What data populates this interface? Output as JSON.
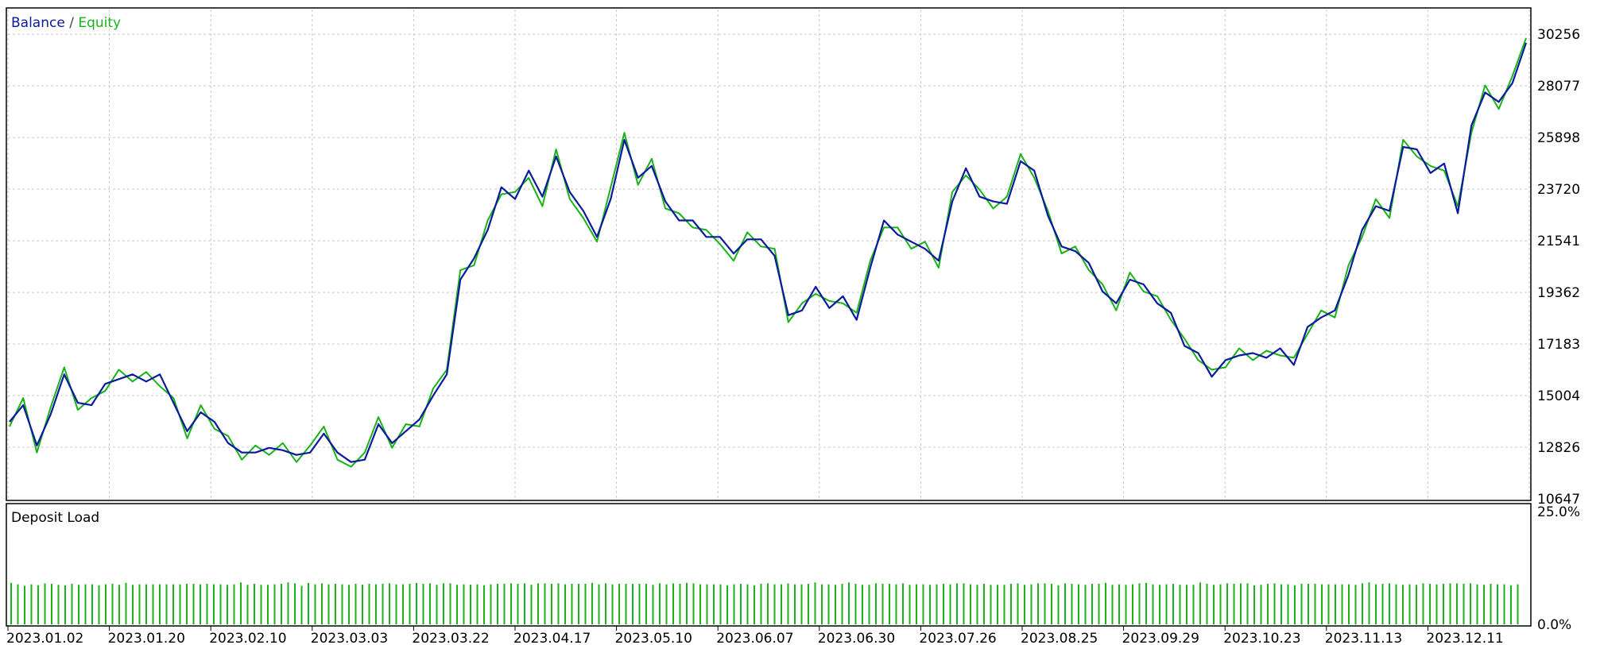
{
  "chart_data": [
    {
      "type": "line",
      "legend": {
        "placement": "top-left",
        "separator": " / "
      },
      "series": [
        {
          "name": "Balance",
          "color": "#0a1a9c",
          "values": [
            13900,
            14600,
            12900,
            14200,
            15900,
            14700,
            14600,
            15500,
            15700,
            15900,
            15600,
            15900,
            14700,
            13500,
            14300,
            13900,
            13000,
            12600,
            12600,
            12800,
            12700,
            12500,
            12600,
            13400,
            12600,
            12200,
            12300,
            13800,
            13000,
            13500,
            14000,
            15000,
            15900,
            19900,
            20800,
            22000,
            23800,
            23300,
            24500,
            23400,
            25100,
            23600,
            22800,
            21700,
            23300,
            25800,
            24200,
            24700,
            23200,
            22400,
            22400,
            21700,
            21700,
            21000,
            21600,
            21600,
            20900,
            18400,
            18600,
            19600,
            18700,
            19200,
            18200,
            20400,
            22400,
            21800,
            21500,
            21200,
            20700,
            23200,
            24600,
            23400,
            23200,
            23100,
            24900,
            24500,
            22600,
            21300,
            21100,
            20600,
            19400,
            18900,
            19900,
            19700,
            18900,
            18500,
            17100,
            16800,
            15800,
            16500,
            16700,
            16800,
            16600,
            17000,
            16300,
            17900,
            18300,
            18600,
            20100,
            22000,
            23000,
            22800,
            25500,
            25400,
            24400,
            24800,
            22700,
            26400,
            27800,
            27400,
            28200,
            29900
          ]
        },
        {
          "name": "Equity",
          "color": "#19b319",
          "values": [
            13700,
            14900,
            12600,
            14500,
            16200,
            14400,
            14900,
            15200,
            16100,
            15600,
            16000,
            15400,
            14900,
            13200,
            14600,
            13600,
            13300,
            12300,
            12900,
            12500,
            13000,
            12200,
            12900,
            13700,
            12300,
            12000,
            12600,
            14100,
            12800,
            13800,
            13700,
            15300,
            16100,
            20300,
            20500,
            22400,
            23500,
            23600,
            24200,
            23000,
            25400,
            23300,
            22500,
            21500,
            23800,
            26100,
            23900,
            25000,
            22900,
            22700,
            22100,
            22000,
            21400,
            20700,
            21900,
            21300,
            21200,
            18100,
            18900,
            19300,
            19000,
            18900,
            18500,
            20700,
            22100,
            22100,
            21200,
            21500,
            20400,
            23600,
            24300,
            23700,
            22900,
            23400,
            25200,
            24200,
            22800,
            21000,
            21300,
            20300,
            19700,
            18600,
            20200,
            19400,
            19200,
            18200,
            17400,
            16500,
            16100,
            16200,
            17000,
            16500,
            16900,
            16700,
            16600,
            17600,
            18600,
            18300,
            20500,
            21700,
            23300,
            22500,
            25800,
            25100,
            24700,
            24500,
            23000,
            26100,
            28100,
            27100,
            28500,
            30100
          ]
        }
      ],
      "x": [
        "2023.01.02",
        "2023.01.20",
        "2023.02.10",
        "2023.03.03",
        "2023.03.22",
        "2023.04.17",
        "2023.05.10",
        "2023.06.07",
        "2023.06.30",
        "2023.07.26",
        "2023.08.25",
        "2023.09.29",
        "2023.10.23",
        "2023.11.13",
        "2023.12.11"
      ],
      "ylim": [
        10647,
        31300
      ],
      "yticks": [
        "30256",
        "28077",
        "25898",
        "23720",
        "21541",
        "19362",
        "17183",
        "15004",
        "12826",
        "10647"
      ],
      "grid": true
    },
    {
      "type": "bar",
      "title": "Deposit Load",
      "color": "#19b319",
      "ylim": [
        0,
        25
      ],
      "yticks": [
        "25.0%",
        "0.0%"
      ],
      "values": [
        8.7,
        8.4,
        8.1,
        8.4,
        8.2,
        8.6,
        8.5,
        8.3,
        8.2,
        8.5,
        8.3,
        8.4,
        8.4,
        8.2,
        8.4,
        8.5,
        8.3,
        8.7,
        8.3,
        8.4,
        8.4,
        8.4,
        8.4,
        8.4,
        8.4,
        8.4,
        8.5,
        8.5,
        8.4,
        8.5,
        8.4,
        8.4,
        8.3,
        8.4,
        8.8,
        8.3,
        8.5,
        8.3,
        8.3,
        8.4,
        8.5,
        8.8,
        8.6,
        8.1,
        8.7,
        8.4,
        8.6,
        8.4,
        8.5,
        8.4,
        8.3,
        8.5,
        8.3,
        8.5,
        8.4,
        8.5,
        8.6,
        8.4,
        8.4,
        8.5,
        8.7,
        8.5,
        8.6,
        8.3,
        8.6,
        8.6,
        8.3,
        8.4,
        8.3,
        8.4,
        8.2,
        8.4,
        8.5,
        8.5,
        8.6,
        8.5,
        8.6,
        8.3,
        8.6,
        8.6,
        8.5,
        8.6,
        8.4,
        8.5,
        8.5,
        8.5,
        8.7,
        8.4,
        8.6,
        8.4,
        8.5,
        8.5,
        8.5,
        8.5,
        8.5,
        8.3,
        8.6,
        8.4,
        8.6,
        8.5,
        8.7,
        8.6,
        8.4,
        8.4,
        8.4,
        8.4,
        8.2,
        8.4,
        8.5,
        8.4,
        8.2,
        8.5,
        8.6,
        8.4,
        8.4,
        8.6,
        8.4,
        8.4,
        8.5,
        8.8,
        8.4,
        8.4,
        8.3,
        8.5,
        8.8,
        8.5,
        8.3,
        8.3,
        8.6,
        8.5,
        8.5,
        8.4,
        8.6,
        8.3,
        8.4,
        8.4,
        8.3,
        8.4,
        8.5,
        8.4,
        8.6,
        8.6,
        8.4,
        8.3,
        8.5,
        8.3,
        8.3,
        8.3,
        8.5,
        8.6,
        8.3,
        8.4,
        8.6,
        8.6,
        8.5,
        8.2,
        8.6,
        8.5,
        8.4,
        8.3,
        8.5,
        8.5,
        8.7,
        8.3,
        8.4,
        8.3,
        8.4,
        8.6,
        8.7,
        8.4,
        8.3,
        8.4,
        8.5,
        8.3,
        8.3,
        8.3,
        8.8,
        8.5,
        8.3,
        8.4,
        8.6,
        8.5,
        8.6,
        8.6,
        8.2,
        8.3,
        8.5,
        8.6,
        8.4,
        8.4,
        8.2,
        8.5,
        8.5,
        8.5,
        8.4,
        8.4,
        8.4,
        8.4,
        8.4,
        8.3,
        8.6,
        8.8,
        8.4,
        8.5,
        8.6,
        8.4,
        8.3,
        8.4,
        8.3,
        8.6,
        8.5,
        8.4,
        8.5,
        8.6,
        8.6,
        8.5,
        8.6,
        8.4,
        8.3,
        8.5,
        8.4,
        8.4,
        8.2,
        8.4
      ]
    }
  ]
}
